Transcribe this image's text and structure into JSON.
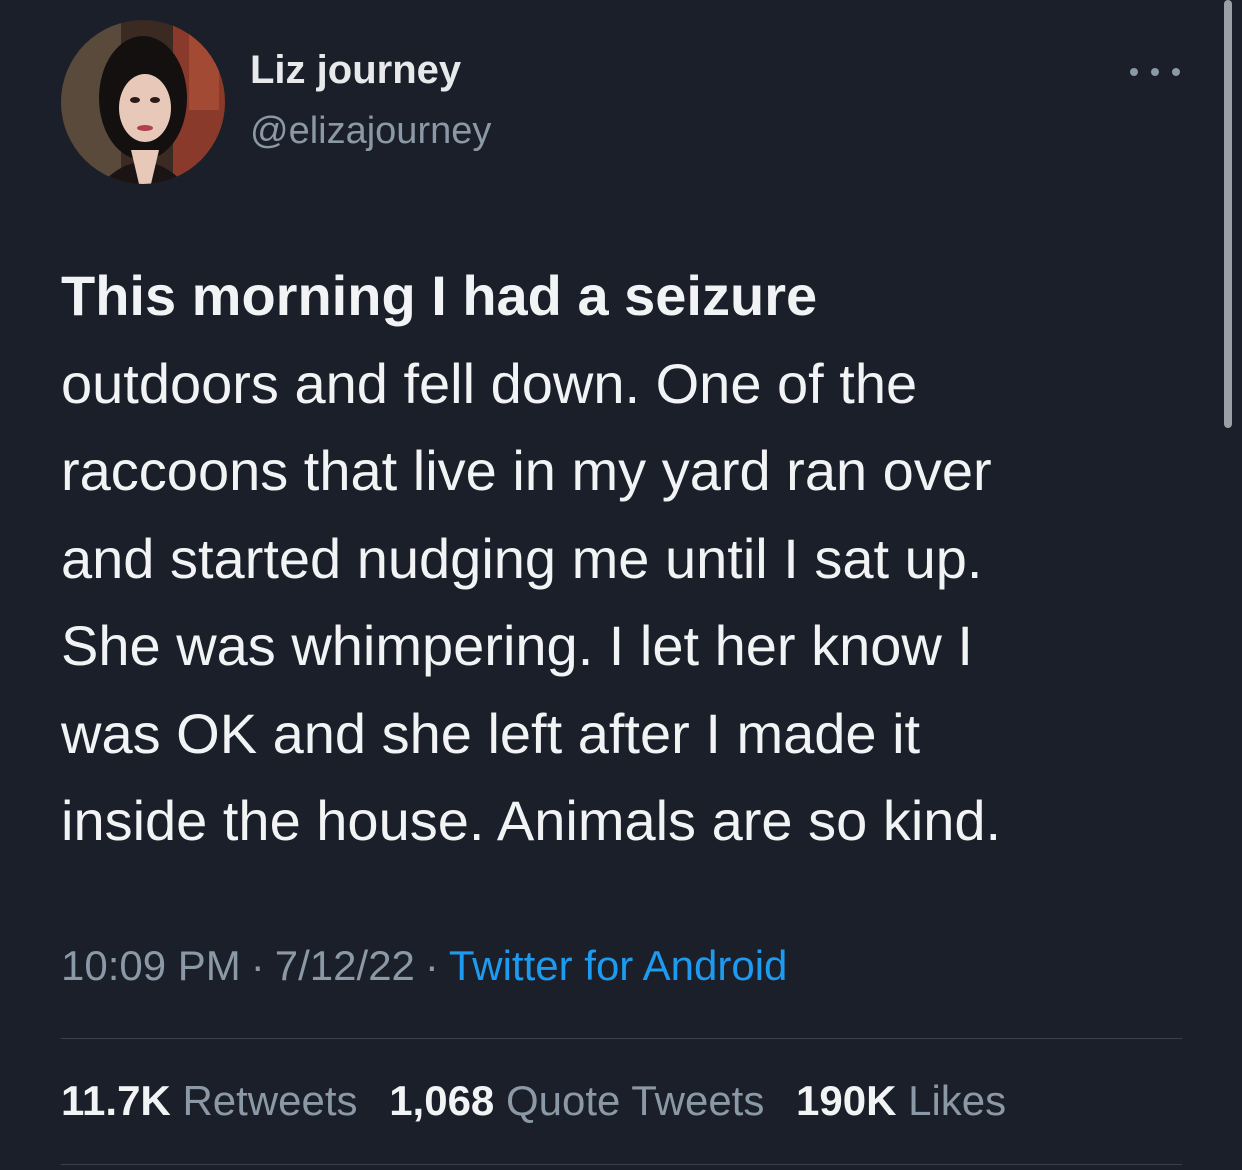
{
  "author": {
    "display_name": "Liz journey",
    "handle": "@elizajourney"
  },
  "more_icon": "more-horizontal-icon",
  "tweet": {
    "lines": [
      {
        "text": "This morning I had a seizure",
        "bold": true
      },
      {
        "text": "outdoors and fell down. One of the",
        "bold": false
      },
      {
        "text": "raccoons that live in my yard ran over",
        "bold": false
      },
      {
        "text": "and started nudging me until I sat up.",
        "bold": false
      },
      {
        "text": "She was whimpering. I let her know I",
        "bold": false
      },
      {
        "text": "was OK and she left after I made it",
        "bold": false
      },
      {
        "text": "inside the house. Animals are so kind.",
        "bold": false
      }
    ]
  },
  "meta": {
    "time": "10:09 PM",
    "separator": "·",
    "date": "7/12/22",
    "source": "Twitter for Android"
  },
  "stats": {
    "retweets": {
      "count": "11.7K",
      "label": "Retweets"
    },
    "quote_tweets": {
      "count": "1,068",
      "label": "Quote Tweets"
    },
    "likes": {
      "count": "190K",
      "label": "Likes"
    }
  },
  "colors": {
    "background": "#1b1f29",
    "primary_text": "#f1f3f4",
    "secondary_text": "#8b98a5",
    "link": "#1d9bf0",
    "divider": "#3a3f48"
  }
}
